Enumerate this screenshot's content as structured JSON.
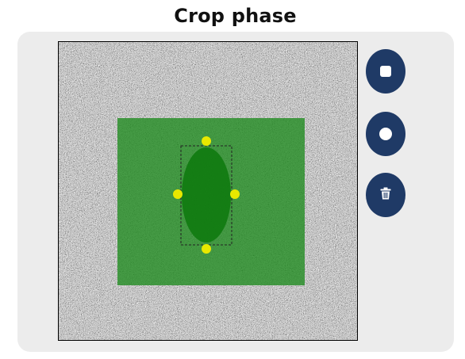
{
  "header": {
    "title": "Crop phase"
  },
  "colors": {
    "panel_background": "#ececec",
    "button_background": "#1f3a66",
    "crop_region": "#1e8a1e",
    "ellipse_fill": "#0f7a0f",
    "handle": "#e8e800"
  },
  "toolbar": {
    "tools": [
      {
        "name": "rectangle-tool",
        "icon": "square-icon"
      },
      {
        "name": "ellipse-tool",
        "icon": "circle-icon"
      },
      {
        "name": "delete-tool",
        "icon": "trash-icon"
      }
    ]
  },
  "canvas": {
    "image": "noise-texture",
    "overlays": [
      "rectangle-crop-region",
      "ellipse-shape-with-four-handles"
    ]
  }
}
